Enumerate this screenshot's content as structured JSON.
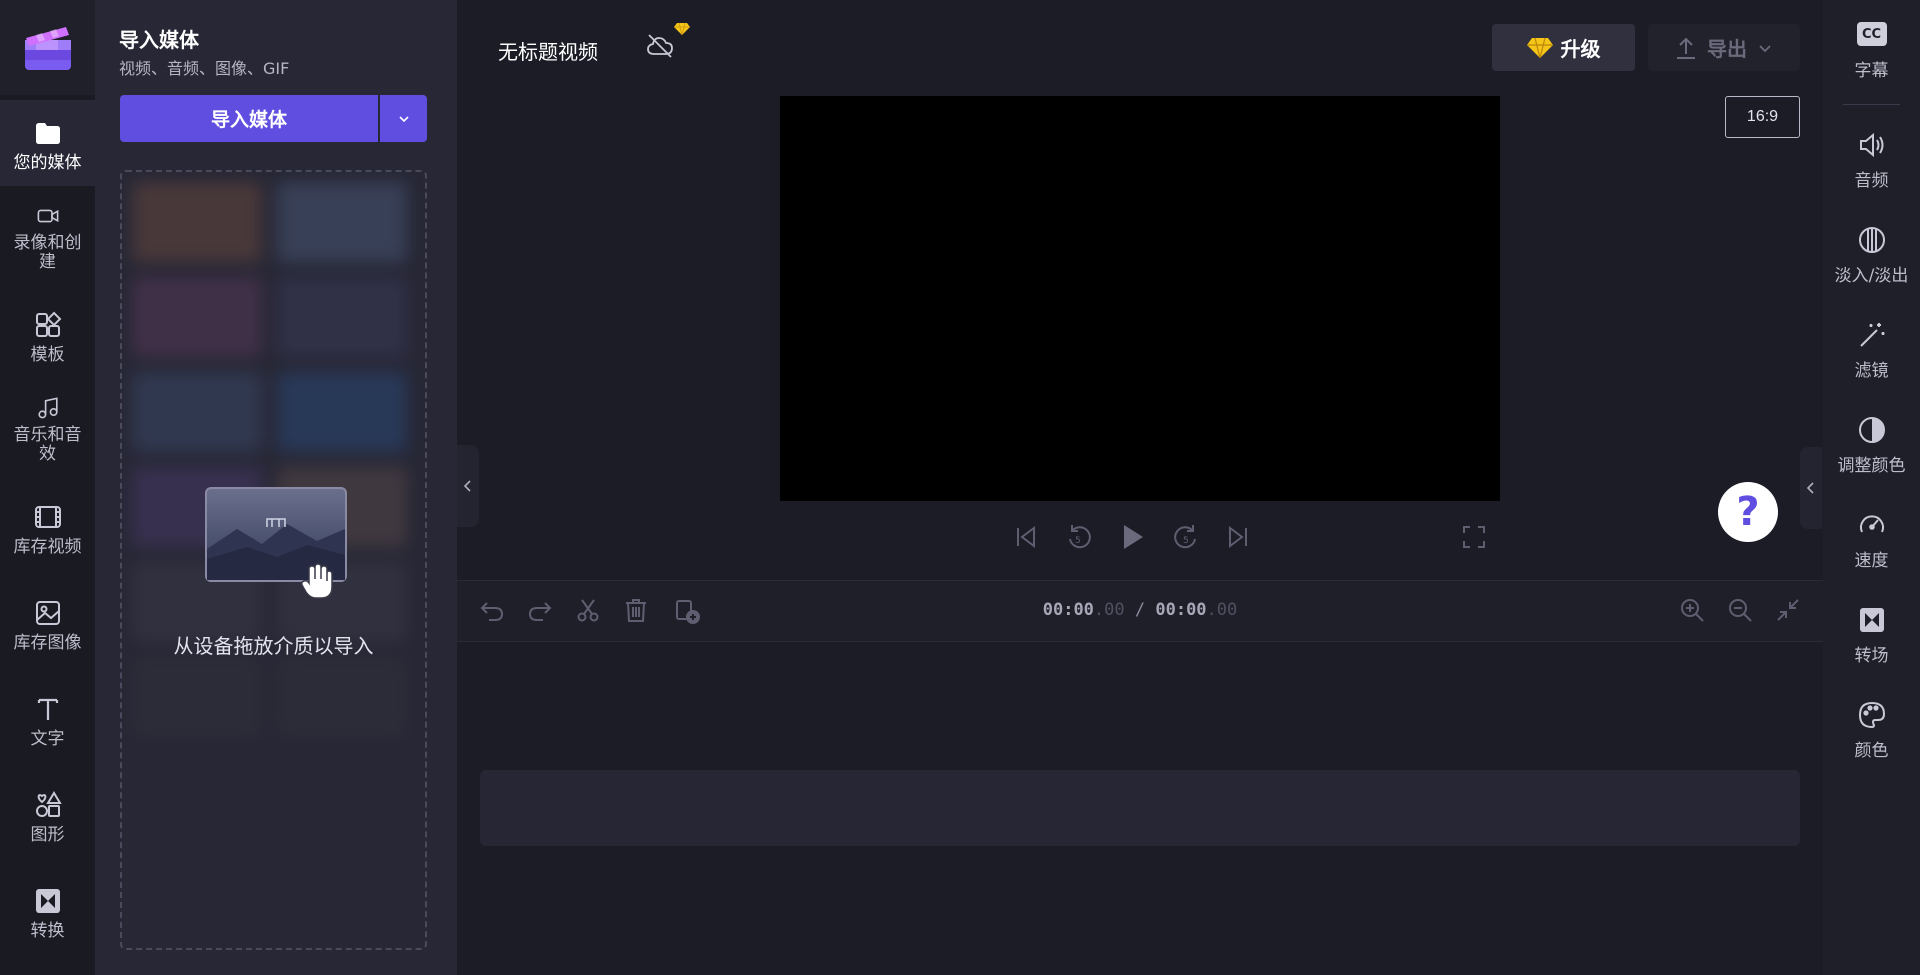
{
  "nav": {
    "items": [
      {
        "label": "您的媒体",
        "icon": "folder-icon"
      },
      {
        "label": "录像和创建",
        "icon": "video-camera-icon"
      },
      {
        "label": "模板",
        "icon": "templates-icon"
      },
      {
        "label": "音乐和音效",
        "icon": "music-note-icon"
      },
      {
        "label": "库存视频",
        "icon": "film-icon"
      },
      {
        "label": "库存图像",
        "icon": "image-icon"
      },
      {
        "label": "文字",
        "icon": "text-icon"
      },
      {
        "label": "图形",
        "icon": "shapes-icon"
      },
      {
        "label": "转换",
        "icon": "transition-icon"
      }
    ]
  },
  "media": {
    "title": "导入媒体",
    "subtitle": "视频、音频、图像、GIF",
    "import_label": "导入媒体",
    "drop_text": "从设备拖放介质以导入"
  },
  "topbar": {
    "project_title": "无标题视频",
    "upgrade_label": "升级",
    "export_label": "导出",
    "aspect_ratio": "16:9"
  },
  "timeline": {
    "time_current_main": "00:00",
    "time_current_ms": ".00",
    "separator": " / ",
    "time_total_main": "00:00",
    "time_total_ms": ".00"
  },
  "help": {
    "label": "?"
  },
  "rightnav": {
    "cc_text": "CC",
    "items": [
      {
        "label": "字幕",
        "icon": "captions-icon"
      },
      {
        "label": "音频",
        "icon": "speaker-icon"
      },
      {
        "label": "淡入/淡出",
        "icon": "fade-icon"
      },
      {
        "label": "滤镜",
        "icon": "magic-wand-icon"
      },
      {
        "label": "调整颜色",
        "icon": "contrast-icon"
      },
      {
        "label": "速度",
        "icon": "speedometer-icon"
      },
      {
        "label": "转场",
        "icon": "transition-icon"
      },
      {
        "label": "颜色",
        "icon": "palette-icon"
      }
    ]
  },
  "colors": {
    "accent": "#5f4ee0",
    "gold": "#f5c518"
  }
}
